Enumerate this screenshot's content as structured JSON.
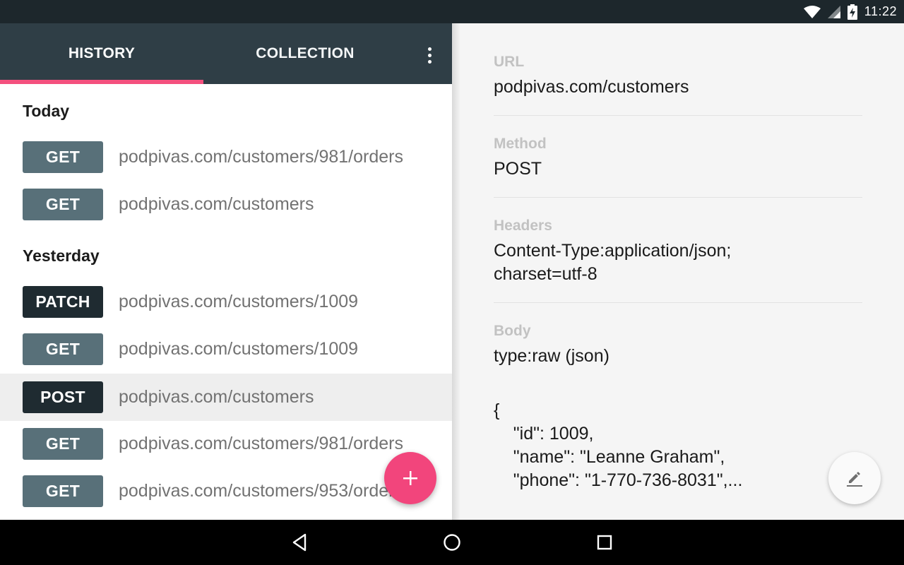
{
  "status_bar": {
    "time": "11:22",
    "icons": [
      "wifi-icon",
      "signal-icon",
      "battery-charging-icon"
    ]
  },
  "tabs": {
    "history_label": "HISTORY",
    "collection_label": "COLLECTION",
    "active": "HISTORY",
    "indicator_color": "#f4507e"
  },
  "history": {
    "today_label": "Today",
    "today": [
      {
        "method": "GET",
        "url": "podpivas.com/customers/981/orders"
      },
      {
        "method": "GET",
        "url": "podpivas.com/customers"
      }
    ],
    "yesterday_label": "Yesterday",
    "yesterday": [
      {
        "method": "PATCH",
        "url": "podpivas.com/customers/1009"
      },
      {
        "method": "GET",
        "url": "podpivas.com/customers/1009"
      },
      {
        "method": "POST",
        "url": "podpivas.com/customers",
        "selected": true
      },
      {
        "method": "GET",
        "url": "podpivas.com/customers/981/orders"
      },
      {
        "method": "GET",
        "url": "podpivas.com/customers/953/orders"
      }
    ]
  },
  "fab": {
    "icon": "plus-icon",
    "color": "#f2457c"
  },
  "detail": {
    "url_label": "URL",
    "url_value": "podpivas.com/customers",
    "method_label": "Method",
    "method_value": "POST",
    "headers_label": "Headers",
    "headers_line1": "Content-Type:application/json;",
    "headers_line2": "charset=utf-8",
    "body_label": "Body",
    "body_type": "type:raw (json)",
    "body_json": "{\n    \"id\": 1009,\n    \"name\": \"Leanne Graham\",\n    \"phone\": \"1-770-736-8031\",..."
  },
  "edit_fab": {
    "icon": "pencil-icon"
  },
  "nav_bar": {
    "buttons": [
      "back-icon",
      "home-icon",
      "recents-icon"
    ]
  }
}
